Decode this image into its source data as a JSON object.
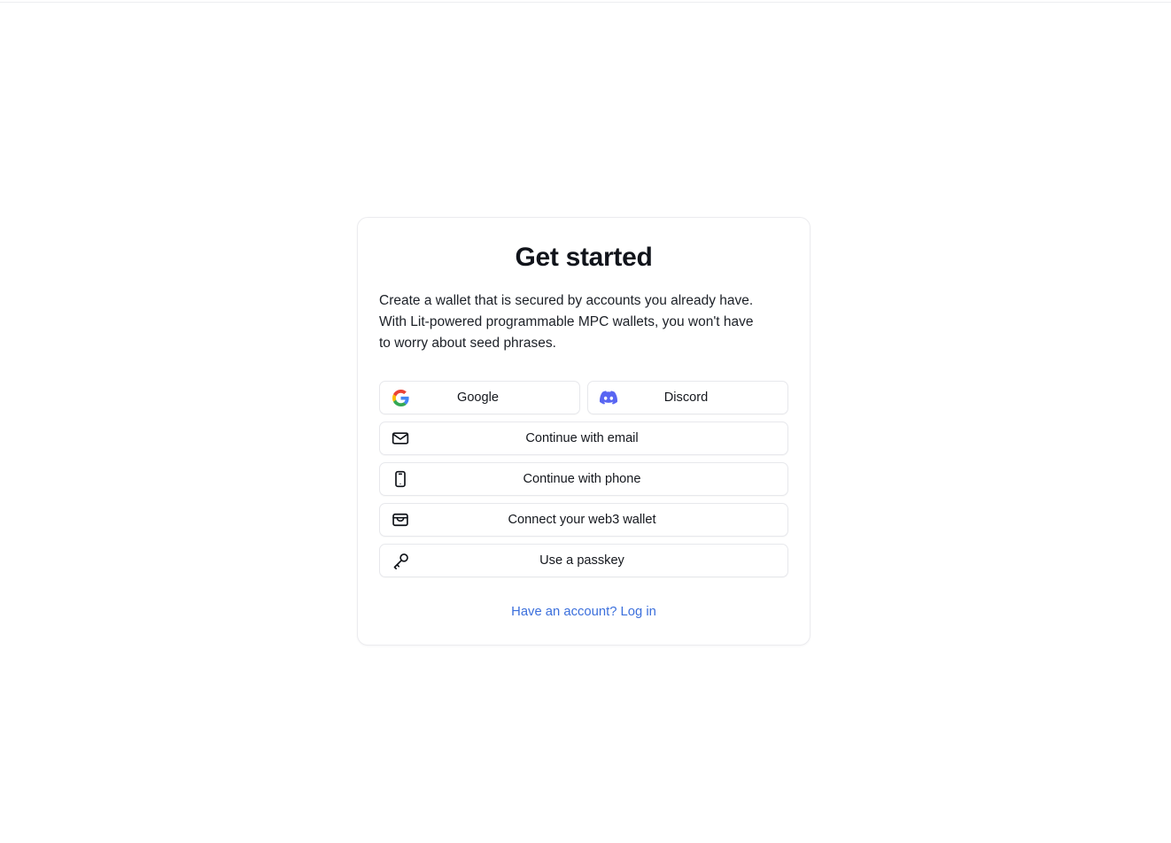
{
  "card": {
    "title": "Get started",
    "description": "Create a wallet that is secured by accounts you already have. With Lit-powered programmable MPC wallets, you won't have to worry about seed phrases.",
    "providers": [
      {
        "label": "Google",
        "icon": "google-icon"
      },
      {
        "label": "Discord",
        "icon": "discord-icon"
      }
    ],
    "methods": [
      {
        "label": "Continue with email",
        "icon": "envelope-icon"
      },
      {
        "label": "Continue with phone",
        "icon": "phone-icon"
      },
      {
        "label": "Connect your web3 wallet",
        "icon": "wallet-icon"
      },
      {
        "label": "Use a passkey",
        "icon": "key-icon"
      }
    ],
    "footer": {
      "login_link": "Have an account? Log in"
    }
  },
  "colors": {
    "page_background": "#ffffff",
    "card_border": "#ececef",
    "title_text": "#11141b",
    "body_text": "#1c2027",
    "button_border": "#e7e8ec",
    "link_blue": "#3b6fdc",
    "discord_blurple": "#5865f2",
    "google_blue": "#4285f4",
    "google_red": "#ea4335",
    "google_yellow": "#fbbc05",
    "google_green": "#34a853"
  }
}
